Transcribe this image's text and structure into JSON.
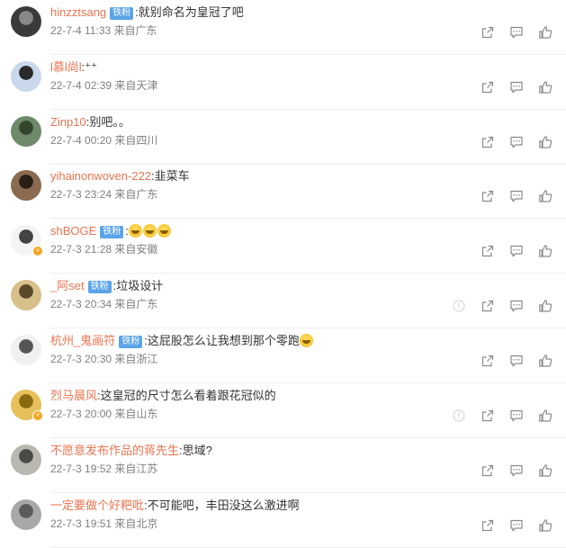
{
  "colors": {
    "username": "#eb7350",
    "fan_badge": "#5ba4e8",
    "meta": "#808080",
    "icon": "#8a8a8a"
  },
  "fan_badge_label": "铁粉",
  "comments": [
    {
      "username": "hinzztsang",
      "fan": true,
      "text": ":就别命名为皇冠了吧",
      "emojis": 0,
      "time": "22-7-4 11:33",
      "location": "来自广东",
      "report": false,
      "avatar_colors": [
        "#3a3a3a",
        "#888888"
      ]
    },
    {
      "username": "l慕l尚l",
      "fan": false,
      "text": ":⁺⁺",
      "emojis": 0,
      "time": "22-7-4 02:39",
      "location": "来自天津",
      "report": false,
      "avatar_colors": [
        "#c9d8ea",
        "#2a2a2a"
      ]
    },
    {
      "username": "Zinp10",
      "fan": false,
      "text": ":别吧。。",
      "emojis": 0,
      "time": "22-7-4 00:20",
      "location": "来自四川",
      "report": false,
      "avatar_colors": [
        "#6e8a6a",
        "#34452e"
      ]
    },
    {
      "username": "yihainonwoven-222",
      "fan": false,
      "text": ":韭菜车",
      "emojis": 0,
      "time": "22-7-3 23:24",
      "location": "来自广东",
      "report": false,
      "avatar_colors": [
        "#8a6a50",
        "#2a1e16"
      ]
    },
    {
      "username": "shBOGE",
      "fan": true,
      "text": ":",
      "emojis": 3,
      "time": "22-7-3 21:28",
      "location": "来自安徽",
      "report": false,
      "verified": true,
      "avatar_colors": [
        "#f4f4f4",
        "#444444"
      ]
    },
    {
      "username": "_阿set",
      "fan": true,
      "text": ":垃圾设计",
      "emojis": 0,
      "time": "22-7-3 20:34",
      "location": "来自广东",
      "report": true,
      "avatar_colors": [
        "#d7c08a",
        "#5a4a2a"
      ]
    },
    {
      "username": "杭州_鬼画符",
      "fan": true,
      "text": ":这屁股怎么让我想到那个零跑",
      "emojis": 1,
      "time": "22-7-3 20:30",
      "location": "来自浙江",
      "report": false,
      "avatar_colors": [
        "#f0f0f0",
        "#555555"
      ]
    },
    {
      "username": "烈马晨风",
      "fan": false,
      "text": ":这皇冠的尺寸怎么看着跟花冠似的",
      "emojis": 0,
      "time": "22-7-3 20:00",
      "location": "来自山东",
      "report": true,
      "verified": true,
      "avatar_colors": [
        "#e6c05a",
        "#8a6a10"
      ]
    },
    {
      "username": "不愿意发布作品的蒋先生",
      "fan": false,
      "text": ":思域?",
      "emojis": 0,
      "time": "22-7-3 19:52",
      "location": "来自江苏",
      "report": false,
      "avatar_colors": [
        "#b8b8b0",
        "#4a4a44"
      ]
    },
    {
      "username": "一定要做个好粑吡",
      "fan": false,
      "text": ":不可能吧，丰田没这么激进啊",
      "emojis": 0,
      "time": "22-7-3 19:51",
      "location": "来自北京",
      "report": false,
      "avatar_colors": [
        "#a8a8a8",
        "#5a5a5a"
      ]
    }
  ]
}
